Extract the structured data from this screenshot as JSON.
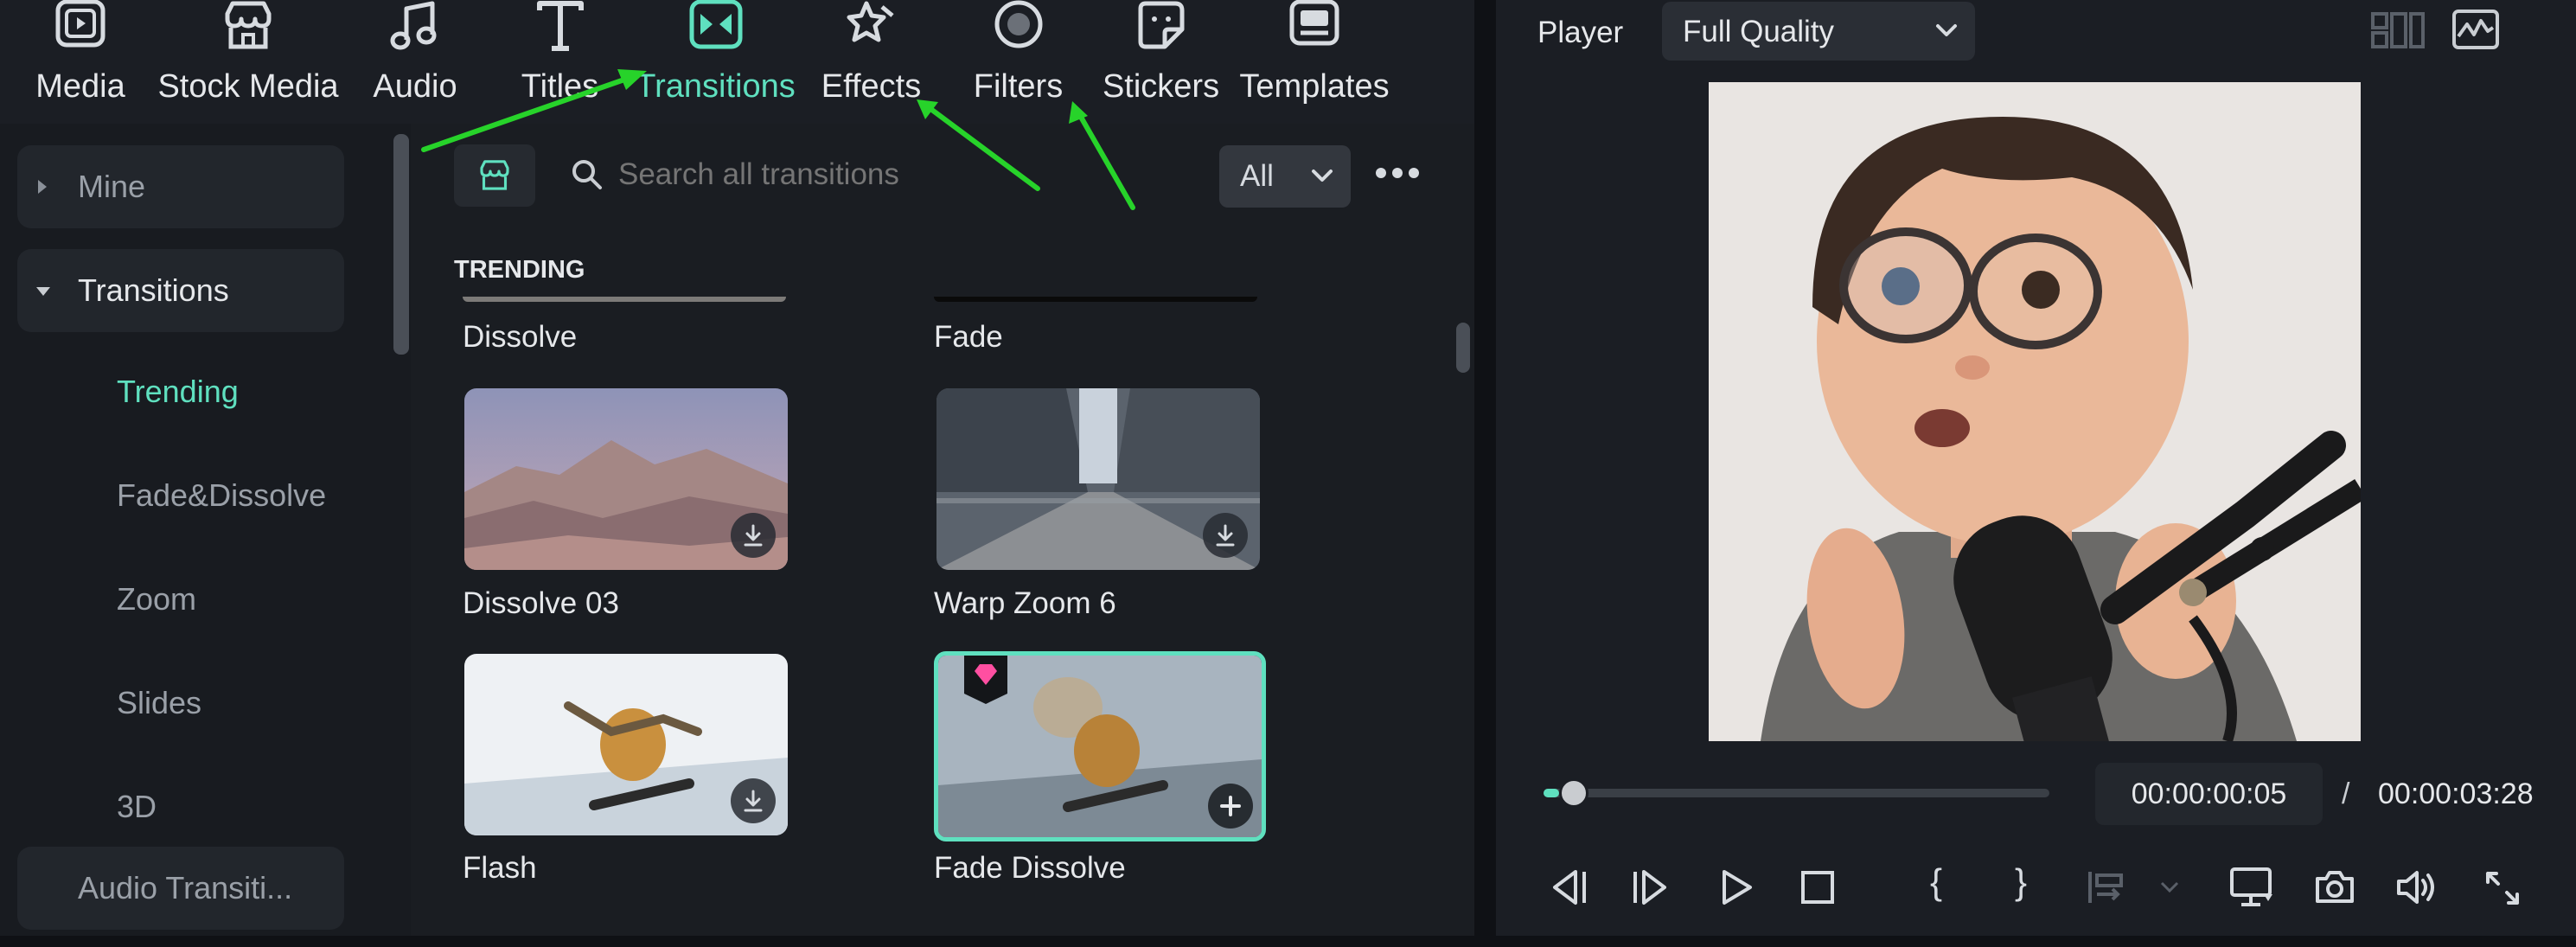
{
  "tabs": [
    {
      "label": "Media",
      "icon": "media-icon"
    },
    {
      "label": "Stock Media",
      "icon": "stock-media-icon"
    },
    {
      "label": "Audio",
      "icon": "audio-icon"
    },
    {
      "label": "Titles",
      "icon": "titles-icon"
    },
    {
      "label": "Transitions",
      "icon": "transitions-icon",
      "active": true
    },
    {
      "label": "Effects",
      "icon": "effects-icon"
    },
    {
      "label": "Filters",
      "icon": "filters-icon"
    },
    {
      "label": "Stickers",
      "icon": "stickers-icon"
    },
    {
      "label": "Templates",
      "icon": "templates-icon"
    }
  ],
  "sidebar": {
    "mine": "Mine",
    "transitions": "Transitions",
    "sub": [
      "Trending",
      "Fade&Dissolve",
      "Zoom",
      "Slides",
      "3D"
    ],
    "audio": "Audio Transiti..."
  },
  "search": {
    "placeholder": "Search all transitions",
    "filter": "All"
  },
  "section": "TRENDING",
  "items": [
    {
      "label": "Dissolve"
    },
    {
      "label": "Fade"
    },
    {
      "label": "Dissolve 03"
    },
    {
      "label": "Warp Zoom 6"
    },
    {
      "label": "Flash"
    },
    {
      "label": "Fade Dissolve",
      "premium": true,
      "selected": true
    }
  ],
  "player": {
    "label": "Player",
    "quality": "Full Quality",
    "current_time": "00:00:00:05",
    "separator": "/",
    "total_time": "00:00:03:28",
    "progress": 0.03
  },
  "colors": {
    "accent": "#5fe0bf",
    "arrow": "#27d32a",
    "premium": "#ff4fa1"
  }
}
